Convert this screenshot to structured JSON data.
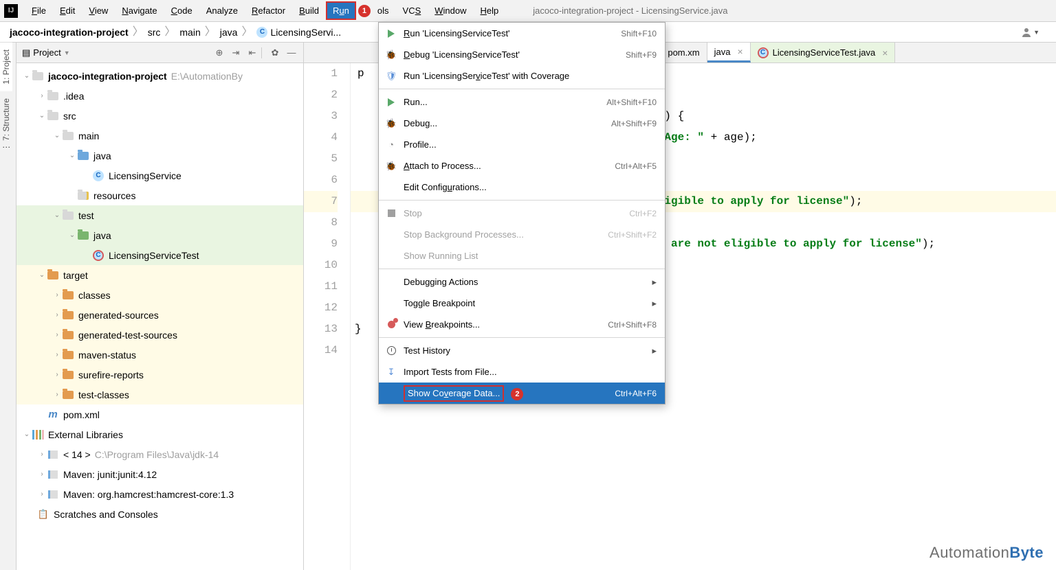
{
  "menubar": {
    "items": [
      "File",
      "Edit",
      "View",
      "Navigate",
      "Code",
      "Analyze",
      "Refactor",
      "Build",
      "Run",
      "Tools",
      "VCS",
      "Window",
      "Help"
    ],
    "mnemonics": [
      "F",
      "E",
      "V",
      "N",
      "C",
      "",
      "R",
      "B",
      "u",
      "",
      "S",
      "W",
      "H"
    ],
    "selected_index": 8,
    "callout_after_selected": "1",
    "window_title": "jacoco-integration-project - LicensingService.java"
  },
  "breadcrumb": {
    "parts": [
      "jacoco-integration-project",
      "src",
      "main",
      "java",
      "LicensingServi..."
    ],
    "bold_first": true,
    "icon_on": 4
  },
  "project_panel": {
    "title": "Project",
    "root": {
      "label": "jacoco-integration-project",
      "path": "E:\\AutomationBy"
    },
    "nodes": [
      {
        "indent": 1,
        "arrow": ">",
        "icon": "folder",
        "label": ".idea"
      },
      {
        "indent": 1,
        "arrow": "v",
        "icon": "folder",
        "label": "src"
      },
      {
        "indent": 2,
        "arrow": "v",
        "icon": "folder",
        "label": "main"
      },
      {
        "indent": 3,
        "arrow": "v",
        "icon": "folder-blue",
        "label": "java"
      },
      {
        "indent": 4,
        "arrow": "",
        "icon": "class",
        "label": "LicensingService"
      },
      {
        "indent": 3,
        "arrow": "",
        "icon": "folder-yellowbar",
        "label": "resources"
      },
      {
        "indent": 2,
        "arrow": "v",
        "icon": "folder",
        "label": "test",
        "hl": "green"
      },
      {
        "indent": 3,
        "arrow": "v",
        "icon": "folder-green",
        "label": "java",
        "hl": "green"
      },
      {
        "indent": 4,
        "arrow": "",
        "icon": "class-test",
        "label": "LicensingServiceTest",
        "hl": "green"
      },
      {
        "indent": 1,
        "arrow": "v",
        "icon": "folder-orange",
        "label": "target",
        "hl": "yellow"
      },
      {
        "indent": 2,
        "arrow": ">",
        "icon": "folder-orange",
        "label": "classes",
        "hl": "yellow"
      },
      {
        "indent": 2,
        "arrow": ">",
        "icon": "folder-orange",
        "label": "generated-sources",
        "hl": "yellow"
      },
      {
        "indent": 2,
        "arrow": ">",
        "icon": "folder-orange",
        "label": "generated-test-sources",
        "hl": "yellow"
      },
      {
        "indent": 2,
        "arrow": ">",
        "icon": "folder-orange",
        "label": "maven-status",
        "hl": "yellow"
      },
      {
        "indent": 2,
        "arrow": ">",
        "icon": "folder-orange",
        "label": "surefire-reports",
        "hl": "yellow"
      },
      {
        "indent": 2,
        "arrow": ">",
        "icon": "folder-orange",
        "label": "test-classes",
        "hl": "yellow"
      },
      {
        "indent": 1,
        "arrow": "",
        "icon": "m",
        "label": "pom.xml"
      }
    ],
    "external_libs": {
      "label": "External Libraries",
      "children": [
        {
          "label": "< 14 >",
          "path": "C:\\Program Files\\Java\\jdk-14"
        },
        {
          "label": "Maven: junit:junit:4.12"
        },
        {
          "label": "Maven: org.hamcrest:hamcrest-core:1.3"
        }
      ]
    },
    "scratches": "Scratches and Consoles"
  },
  "tabs": [
    {
      "label": "pom.xm",
      "icon": "m",
      "active": false
    },
    {
      "label": "java",
      "close": true,
      "active": true,
      "partial_left": true
    },
    {
      "label": "LicensingServiceTest.java",
      "icon": "class-test",
      "close": true,
      "green": true
    }
  ],
  "gutter": {
    "lines": [
      1,
      2,
      3,
      4,
      5,
      6,
      7,
      8,
      9,
      10,
      11,
      12,
      13,
      14
    ],
    "highlight": 7,
    "collapse_marks": [
      3,
      6,
      8,
      9,
      11,
      13
    ]
  },
  "code": [
    {
      "t": "p"
    },
    {
      "t": ""
    },
    {
      "t": " age) {",
      "pre_types": true
    },
    {
      "t": "ded Age: \" + age);",
      "pre_inv": true
    },
    {
      "t": ""
    },
    {
      "t": ""
    },
    {
      "t": "e eligible to apply for license\");",
      "pre_str": true,
      "hl": true
    },
    {
      "t": ""
    },
    {
      "t": " you are not eligible to apply for license\");",
      "pre_str": true
    },
    {
      "t": ""
    },
    {
      "t": ""
    },
    {
      "t": ""
    },
    {
      "t": "}"
    },
    {
      "t": ""
    }
  ],
  "run_menu": {
    "groups": [
      [
        {
          "icon": "play",
          "label": "Run 'LicensingServiceTest'",
          "u": "R",
          "short": "Shift+F10"
        },
        {
          "icon": "bug",
          "label": "Debug 'LicensingServiceTest'",
          "u": "D",
          "short": "Shift+F9"
        },
        {
          "icon": "shield",
          "label": "Run 'LicensingServiceTest' with Coverage",
          "u": "v"
        }
      ],
      [
        {
          "icon": "play",
          "label": "Run...",
          "u": "",
          "short": "Alt+Shift+F10"
        },
        {
          "icon": "bug",
          "label": "Debug...",
          "u": "",
          "short": "Alt+Shift+F9"
        },
        {
          "icon": "profile",
          "label": "Profile...",
          "u": ""
        },
        {
          "icon": "bug",
          "label": "Attach to Process...",
          "u": "A",
          "short": "Ctrl+Alt+F5"
        },
        {
          "icon": "",
          "label": "Edit Configurations...",
          "u": "u"
        }
      ],
      [
        {
          "icon": "stop",
          "label": "Stop",
          "short": "Ctrl+F2",
          "disabled": true
        },
        {
          "icon": "",
          "label": "Stop Background Processes...",
          "short": "Ctrl+Shift+F2",
          "disabled": true
        },
        {
          "icon": "",
          "label": "Show Running List",
          "disabled": true
        }
      ],
      [
        {
          "icon": "",
          "label": "Debugging Actions",
          "submenu": true
        },
        {
          "icon": "",
          "label": "Toggle Breakpoint",
          "submenu": true
        },
        {
          "icon": "breakpoints",
          "label": "View Breakpoints...",
          "u": "B",
          "short": "Ctrl+Shift+F8"
        }
      ],
      [
        {
          "icon": "clock",
          "label": "Test History",
          "submenu": true
        },
        {
          "icon": "import",
          "label": "Import Tests from File..."
        },
        {
          "icon": "",
          "label": "Show Coverage Data...",
          "u": "v",
          "short": "Ctrl+Alt+F6",
          "hover": true,
          "callout": "2"
        }
      ]
    ]
  },
  "watermark": {
    "a": "Automation",
    "b": "Byte"
  }
}
